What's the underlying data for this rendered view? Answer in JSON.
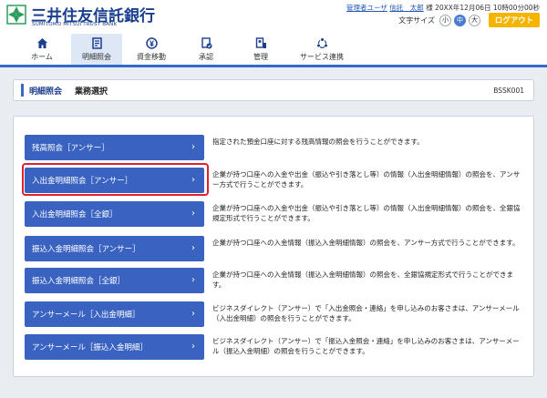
{
  "header": {
    "brand_jp": "三井住友信託銀行",
    "brand_en": "SUMITOMO MITSUI TRUST BANK",
    "user_role": "管理者ユーザ",
    "user_name": "信託　太郎",
    "honorific": "様",
    "datetime": "20XX年12月06日 10時00分00秒",
    "font_size_label": "文字サイズ",
    "font_sizes": [
      "小",
      "中",
      "大"
    ],
    "logout_label": "ログアウト",
    "accent_color": "#3469c9"
  },
  "nav": {
    "items": [
      {
        "label": "ホーム",
        "icon": "home-icon"
      },
      {
        "label": "明細照会",
        "icon": "document-icon"
      },
      {
        "label": "資金移動",
        "icon": "yen-icon"
      },
      {
        "label": "承認",
        "icon": "approval-icon"
      },
      {
        "label": "管理",
        "icon": "admin-icon"
      },
      {
        "label": "サービス連携",
        "icon": "link-icon"
      }
    ]
  },
  "titlebar": {
    "main": "明細照会",
    "sub": "業務選択",
    "code": "BSSK001"
  },
  "rows": [
    {
      "label": "残高照会［アンサー］",
      "desc": "指定された預金口座に対する残高情報の照会を行うことができます。"
    },
    {
      "label": "入出金明細照会［アンサー］",
      "desc": "企業が持つ口座への入金や出金（振込や引き落とし等）の情報（入出金明細情報）の照会を、アンサー方式で行うことができます。"
    },
    {
      "label": "入出金明細照会［全銀］",
      "desc": "企業が持つ口座への入金や出金（振込や引き落とし等）の情報（入出金明細情報）の照会を、全銀協規定形式で行うことができます。"
    },
    {
      "label": "振込入金明細照会［アンサー］",
      "desc": "企業が持つ口座への入金情報（振込入金明細情報）の照会を、アンサー方式で行うことができます。"
    },
    {
      "label": "振込入金明細照会［全銀］",
      "desc": "企業が持つ口座への入金情報（振込入金明細情報）の照会を、全銀協規定形式で行うことができます。"
    },
    {
      "label": "アンサーメール［入出金明細］",
      "desc": "ビジネスダイレクト（アンサー）で「入出金照会・連絡」を申し込みのお客さまは、アンサーメール（入出金明細）の照会を行うことができます。"
    },
    {
      "label": "アンサーメール［振込入金明細］",
      "desc": "ビジネスダイレクト（アンサー）で「振込入金照会・連絡」を申し込みのお客さまは、アンサーメール（振込入金明細）の照会を行うことができます。"
    }
  ],
  "chevron": "›"
}
